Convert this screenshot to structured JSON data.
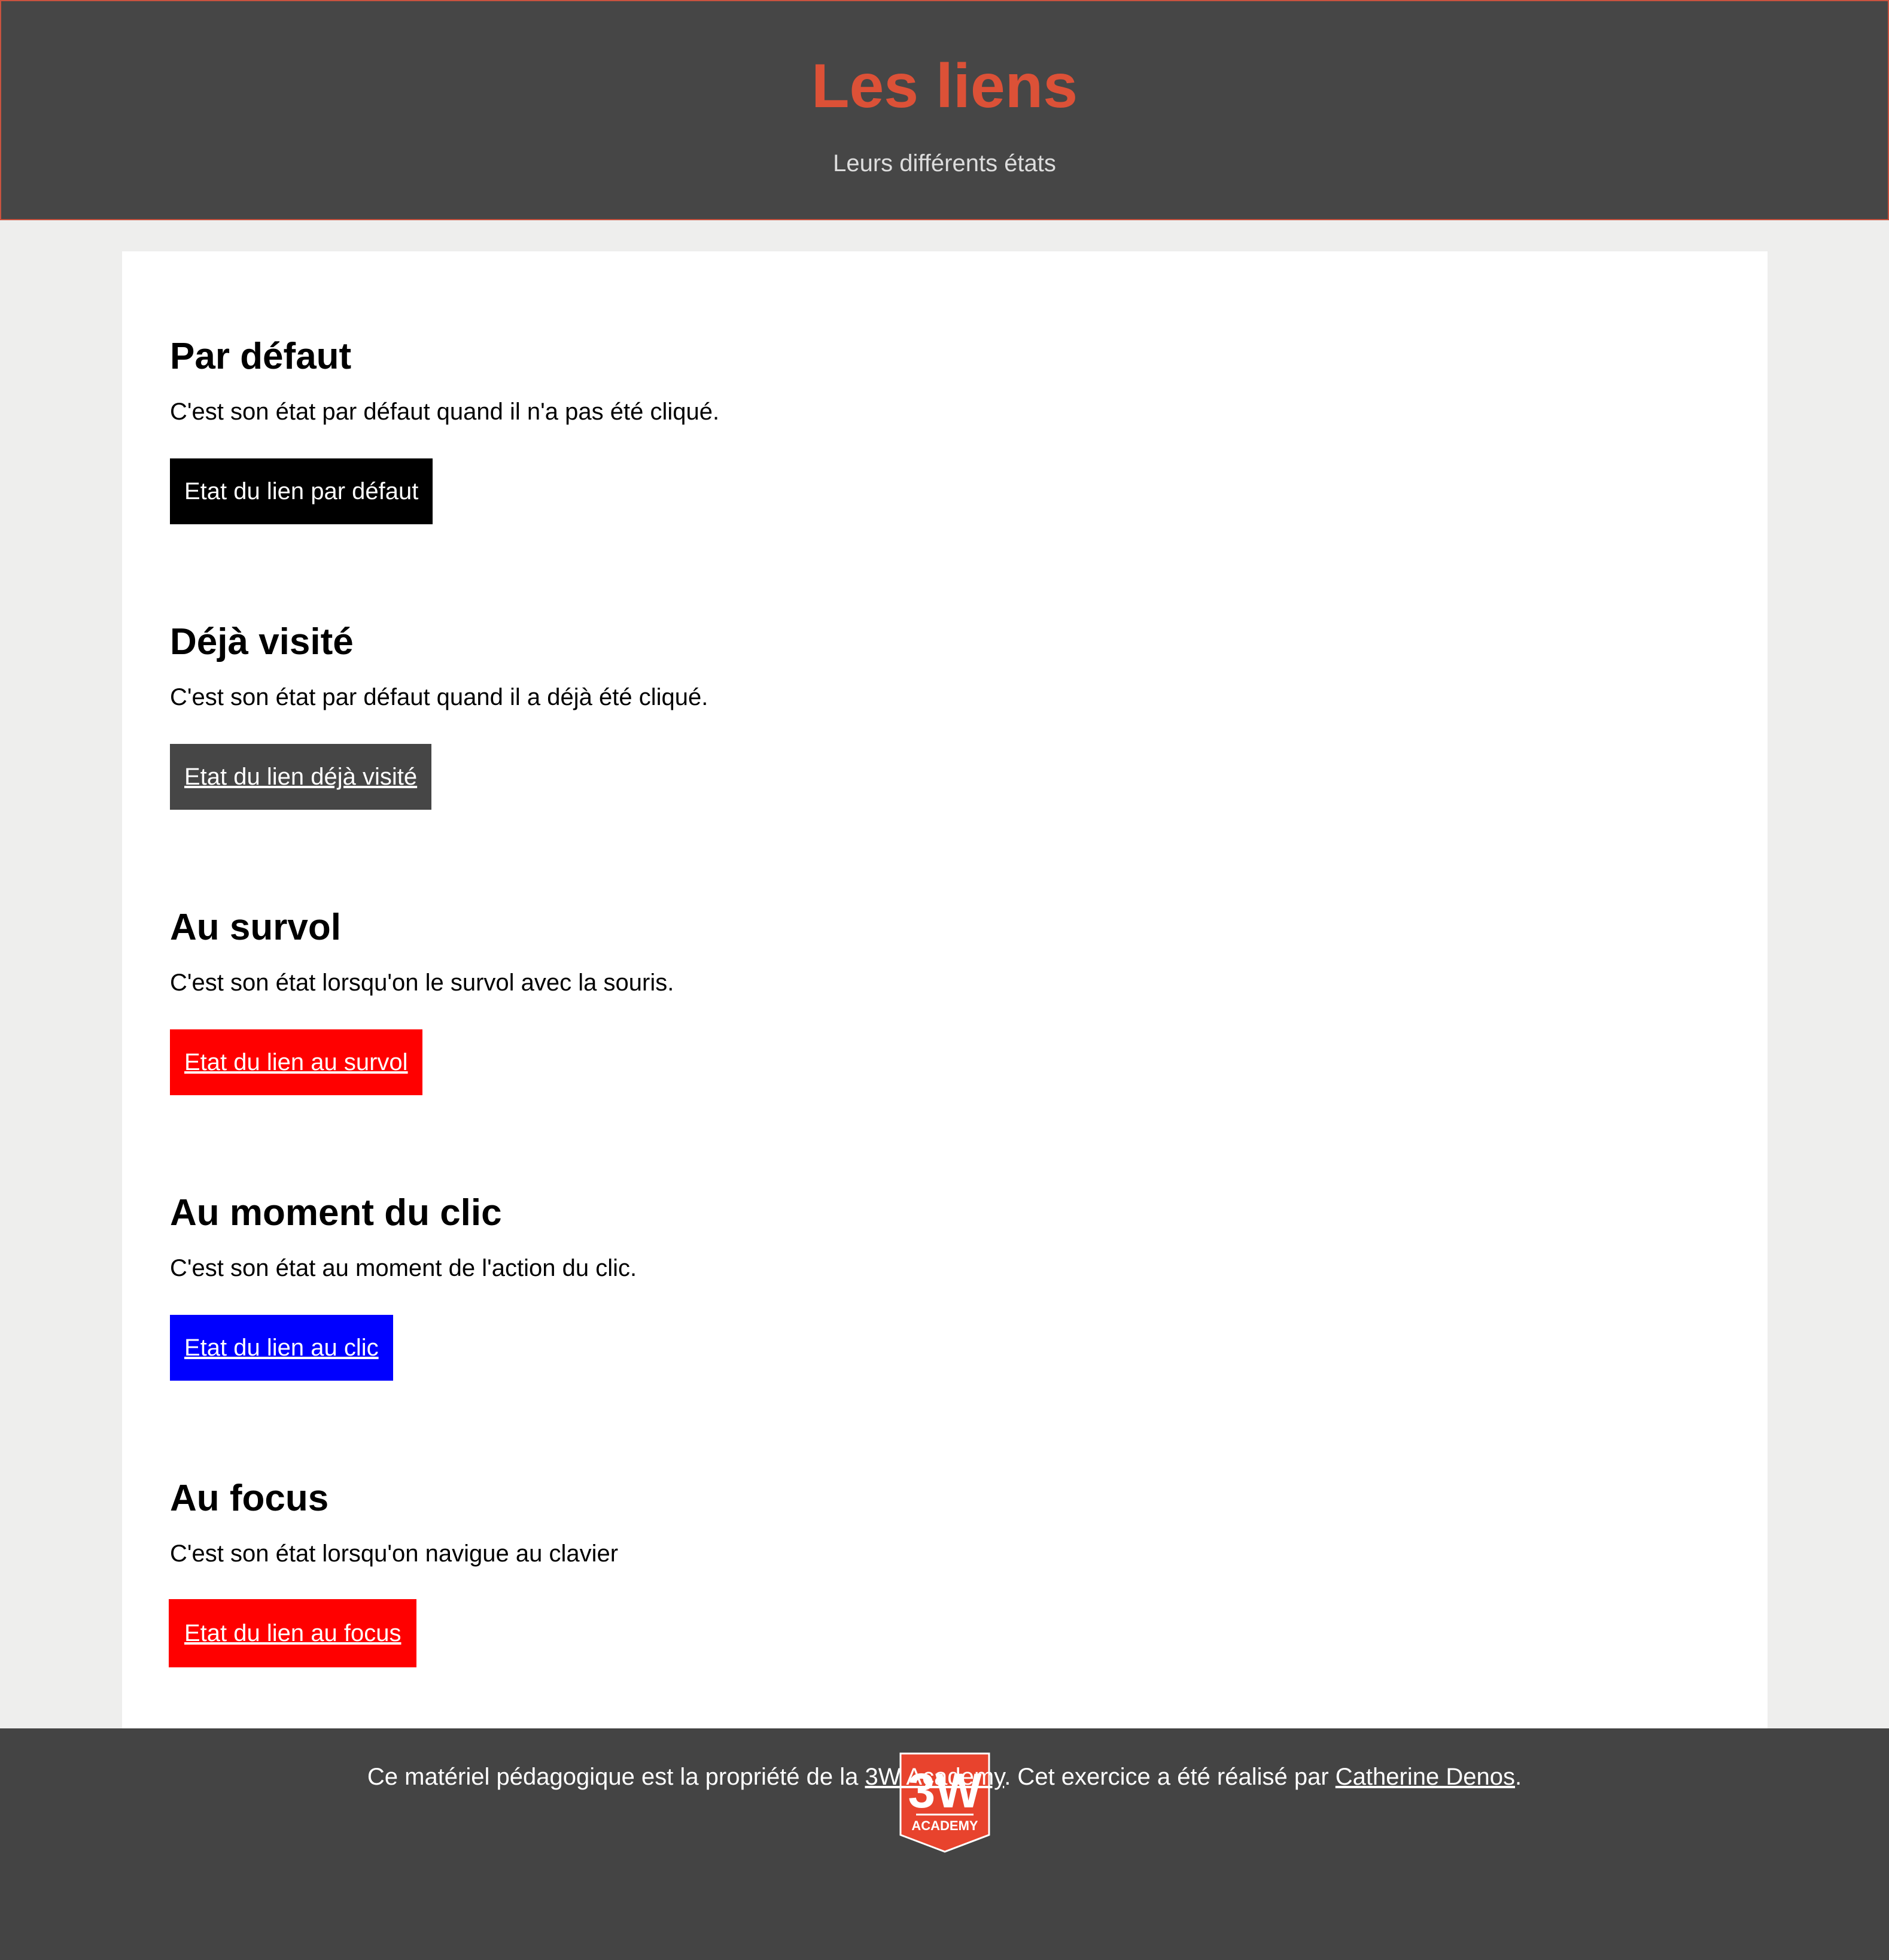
{
  "header": {
    "title": "Les liens",
    "subtitle": "Leurs différents états"
  },
  "sections": [
    {
      "heading": "Par défaut",
      "description": "C'est son état par défaut quand il n'a pas été cliqué.",
      "link_label": "Etat du lien par défaut",
      "link_bg": "#000000"
    },
    {
      "heading": "Déjà visité",
      "description": "C'est son état par défaut quand il a déjà été cliqué.",
      "link_label": "Etat du lien déjà visité",
      "link_bg": "#464646"
    },
    {
      "heading": "Au survol",
      "description": "C'est son état lorsqu'on le survol avec la souris.",
      "link_label": "Etat du lien au survol",
      "link_bg": "#ff0000"
    },
    {
      "heading": "Au moment du clic",
      "description": "C'est son état au moment de l'action du clic.",
      "link_label": "Etat du lien au clic",
      "link_bg": "#0000ff"
    },
    {
      "heading": "Au focus",
      "description": "C'est son état lorsqu'on navigue au clavier",
      "link_label": "Etat du lien au focus",
      "link_bg": "#ff0000"
    }
  ],
  "footer": {
    "logo_icon": "3w-academy-logo-icon",
    "logo_main": "3W",
    "logo_sub": "ACADEMY",
    "text_before": "Ce matériel pédagogique est la propriété de la ",
    "link1": "3W Academy",
    "text_middle": ". Cet exercice a été réalisé par ",
    "link2": "Catherine Denos",
    "text_after": "."
  },
  "colors": {
    "header_bg": "#464646",
    "title": "#dc5137",
    "page_bg": "#eeeeed",
    "footer_bg": "#444444",
    "logo_red": "#e8432d"
  }
}
